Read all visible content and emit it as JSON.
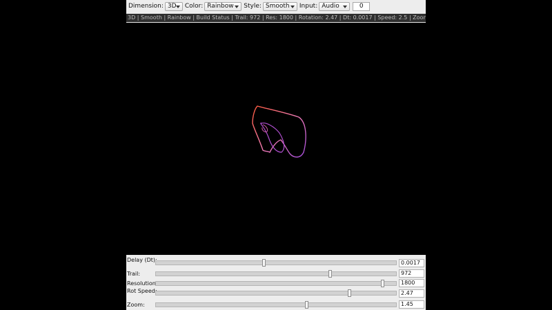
{
  "toolbar": {
    "dimension_label": "Dimension:",
    "dimension_value": "3D",
    "color_label": "Color:",
    "color_value": "Rainbow",
    "style_label": "Style:",
    "style_value": "Smooth",
    "input_label": "Input:",
    "input_value": "Audio",
    "channel_value": "0"
  },
  "status_text": "3D | Smooth | Rainbow | Build Status | Trail: 972 | Res: 1800 | Rotation: 2.47 | Dt: 0.0017 | Speed: 2.5 | Zoom: 1.45",
  "controls": {
    "delay_label": "Delay (Dt):",
    "delay_value": "0.0017",
    "delay_fraction": 0.45,
    "trail_label": "Trail:",
    "trail_value": "972",
    "trail_fraction": 0.73,
    "resolution_label": "Resolution",
    "resolution_value": "1800",
    "resolution_fraction": 0.95,
    "rot_label": "Rot Speed:",
    "rot_value": "2.47",
    "rot_fraction": 0.81,
    "zoom_label": "Zoom:",
    "zoom_value": "1.45",
    "zoom_fraction": 0.63
  },
  "colors": {
    "curve_start": "#ff5a3c",
    "curve_mid": "#f07bb0",
    "curve_end": "#a04bd8"
  }
}
